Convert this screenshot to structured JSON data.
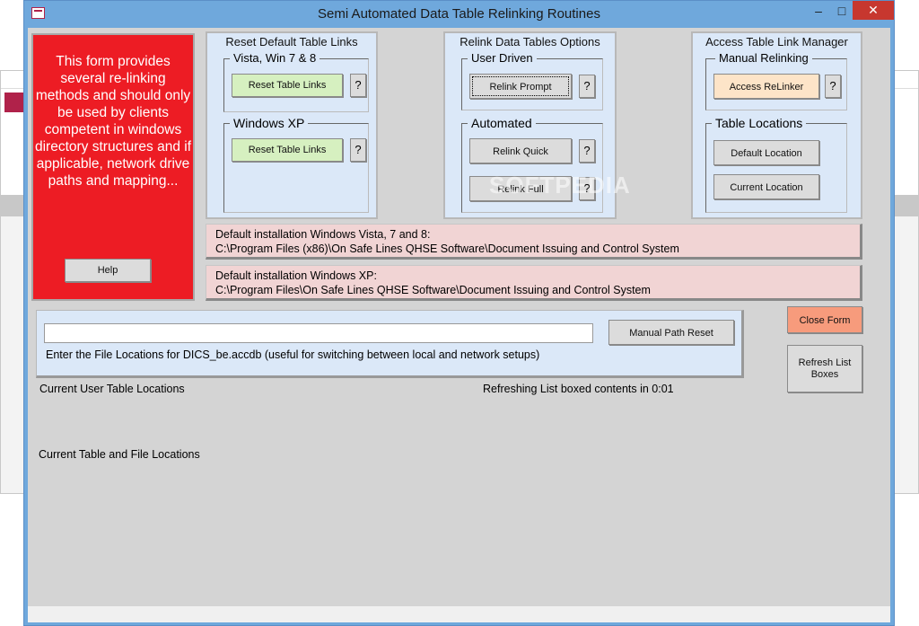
{
  "window": {
    "title": "Semi Automated Data Table Relinking Routines",
    "controls": {
      "minimize": "–",
      "maximize": "□",
      "close": "✕"
    }
  },
  "info": {
    "text": "This form provides several re-linking methods and should only be used by clients competent in windows directory structures and if applicable, network drive paths and mapping...",
    "help_label": "Help"
  },
  "reset_panel": {
    "title": "Reset Default Table Links",
    "vista_group": "Vista, Win 7 & 8",
    "vista_button": "Reset Table Links",
    "xp_group": "Windows XP",
    "xp_button": "Reset Table Links",
    "help_q": "?"
  },
  "relink_panel": {
    "title": "Relink Data Tables Options",
    "user_group": "User Driven",
    "prompt_button": "Relink Prompt",
    "auto_group": "Automated",
    "quick_button": "Relink Quick",
    "full_button": "Relink Full",
    "help_q": "?"
  },
  "access_panel": {
    "title": "Access Table Link Manager",
    "manual_group": "Manual Relinking",
    "relinker_button": "Access ReLinker",
    "locations_group": "Table Locations",
    "default_button": "Default Location",
    "current_button": "Current Location",
    "help_q": "?"
  },
  "defaults": {
    "vista_heading": "Default installation Windows Vista, 7 and 8:",
    "vista_path": "C:\\Program Files (x86)\\On Safe Lines QHSE Software\\Document Issuing and Control System",
    "xp_heading": "Default installation Windows XP:",
    "xp_path": "C:\\Program Files\\On Safe Lines QHSE Software\\Document Issuing and Control System"
  },
  "path_reset": {
    "input_value": "",
    "button": "Manual Path Reset",
    "hint": "Enter the File Locations for DICS_be.accdb (useful for switching between local and network setups)"
  },
  "side_buttons": {
    "close_form": "Close Form",
    "refresh": "Refresh List Boxes"
  },
  "status": {
    "user_locations": "Current User Table Locations",
    "refreshing": "Refreshing List boxed contents in 0:01",
    "file_locations": "Current Table and File Locations"
  },
  "watermark": "SOFTPEDIA"
}
